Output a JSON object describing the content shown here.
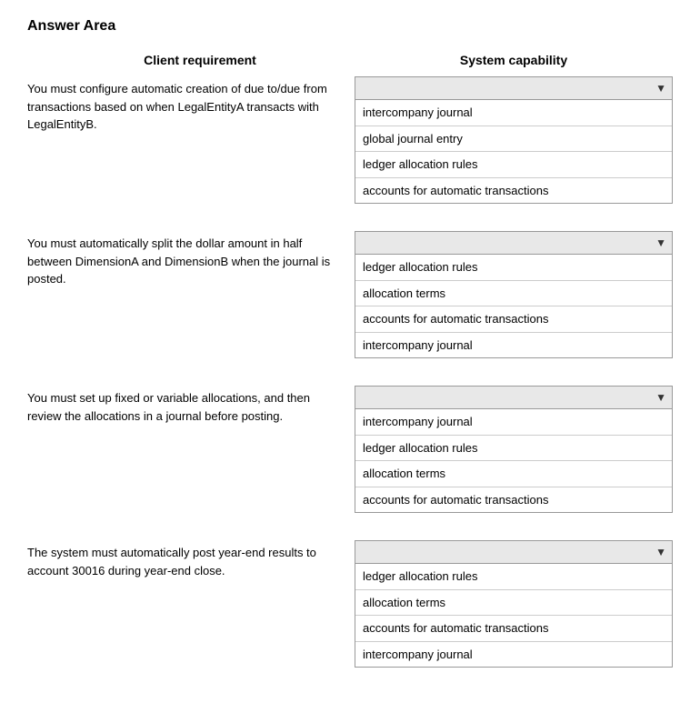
{
  "title": "Answer Area",
  "columns": {
    "requirement": "Client requirement",
    "capability": "System capability"
  },
  "rows": [
    {
      "id": "row1",
      "requirement": "You must configure automatic creation of due to/due from transactions based on when LegalEntityA transacts with LegalEntityB.",
      "selected": "",
      "options": [
        "intercompany journal",
        "global journal entry",
        "ledger allocation rules",
        "accounts for automatic transactions"
      ]
    },
    {
      "id": "row2",
      "requirement": "You must automatically split the dollar amount in half between DimensionA and DimensionB when the journal is posted.",
      "selected": "",
      "options": [
        "ledger allocation rules",
        "allocation terms",
        "accounts for automatic transactions",
        "intercompany journal"
      ]
    },
    {
      "id": "row3",
      "requirement": "You must set up fixed or variable allocations, and then review the allocations in a journal before posting.",
      "selected": "",
      "options": [
        "intercompany journal",
        "ledger allocation rules",
        "allocation terms",
        "accounts for automatic transactions"
      ]
    },
    {
      "id": "row4",
      "requirement": "The system must automatically post year-end results to account 30016 during year-end close.",
      "selected": "",
      "options": [
        "ledger allocation rules",
        "allocation terms",
        "accounts for automatic transactions",
        "intercompany journal"
      ]
    }
  ]
}
